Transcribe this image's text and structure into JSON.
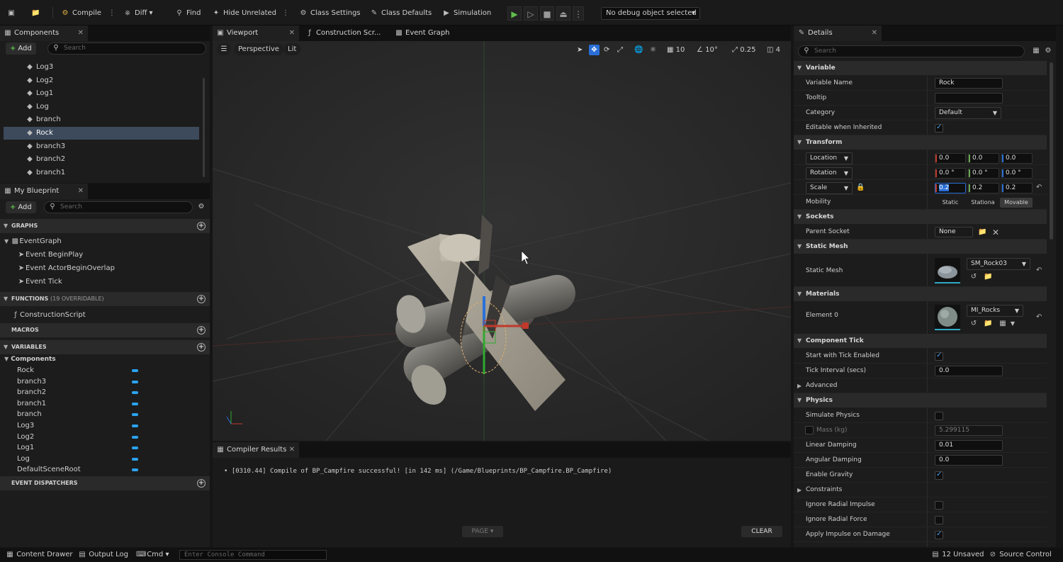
{
  "toolbar": {
    "compile": "Compile",
    "diff": "Diff",
    "find": "Find",
    "hide_unrelated": "Hide Unrelated",
    "class_settings": "Class Settings",
    "class_defaults": "Class Defaults",
    "simulation": "Simulation",
    "debug_object": "No debug object selected"
  },
  "components_panel": {
    "tab": "Components",
    "add": "Add",
    "search_placeholder": "Search",
    "items": [
      "Log3",
      "Log2",
      "Log1",
      "Log",
      "branch",
      "Rock",
      "branch3",
      "branch2",
      "branch1"
    ],
    "selected": "Rock"
  },
  "blueprint_panel": {
    "tab": "My Blueprint",
    "add": "Add",
    "search_placeholder": "Search",
    "graphs_header": "GRAPHS",
    "event_graph": "EventGraph",
    "events": [
      "Event BeginPlay",
      "Event ActorBeginOverlap",
      "Event Tick"
    ],
    "functions_header": "FUNCTIONS",
    "functions_count": "(19 OVERRIDABLE)",
    "construction_script": "ConstructionScript",
    "macros_header": "MACROS",
    "variables_header": "VARIABLES",
    "components_group": "Components",
    "variables": [
      "Rock",
      "branch3",
      "branch2",
      "branch1",
      "branch",
      "Log3",
      "Log2",
      "Log1",
      "Log",
      "DefaultSceneRoot"
    ],
    "dispatchers_header": "EVENT DISPATCHERS"
  },
  "editor_tabs": [
    "Viewport",
    "Construction Scr...",
    "Event Graph"
  ],
  "viewport": {
    "perspective": "Perspective",
    "lit": "Lit",
    "grid_snap": "10",
    "rot_snap": "10°",
    "scale_snap": "0.25",
    "camera_speed": "4"
  },
  "compiler": {
    "tab": "Compiler Results",
    "message": "• [0310.44] Compile of BP_Campfire successful! [in 142 ms] (/Game/Blueprints/BP_Campfire.BP_Campfire)",
    "page": "PAGE",
    "clear": "CLEAR"
  },
  "details": {
    "tab": "Details",
    "search_placeholder": "Search",
    "variable_header": "Variable",
    "variable_name_label": "Variable Name",
    "variable_name": "Rock",
    "tooltip_label": "Tooltip",
    "category_label": "Category",
    "category": "Default",
    "editable_label": "Editable when Inherited",
    "transform_header": "Transform",
    "location_label": "Location",
    "location": [
      "0.0",
      "0.0",
      "0.0"
    ],
    "rotation_label": "Rotation",
    "rotation": [
      "0.0 °",
      "0.0 °",
      "0.0 °"
    ],
    "scale_label": "Scale",
    "scale": [
      "0.2",
      "0.2",
      "0.2"
    ],
    "mobility_label": "Mobility",
    "mobility_options": [
      "Static",
      "Stationa",
      "Movable"
    ],
    "sockets_header": "Sockets",
    "parent_socket_label": "Parent Socket",
    "parent_socket": "None",
    "static_mesh_header": "Static Mesh",
    "static_mesh_label": "Static Mesh",
    "static_mesh": "SM_Rock03",
    "materials_header": "Materials",
    "element0_label": "Element 0",
    "element0": "MI_Rocks",
    "tick_header": "Component Tick",
    "start_tick_label": "Start with Tick Enabled",
    "tick_interval_label": "Tick Interval (secs)",
    "tick_interval": "0.0",
    "advanced_label": "Advanced",
    "physics_header": "Physics",
    "simulate_label": "Simulate Physics",
    "mass_label": "Mass (kg)",
    "mass": "5.299115",
    "linear_damping_label": "Linear Damping",
    "linear_damping": "0.01",
    "angular_damping_label": "Angular Damping",
    "angular_damping": "0.0",
    "gravity_label": "Enable Gravity",
    "constraints_label": "Constraints",
    "ignore_radial_impulse_label": "Ignore Radial Impulse",
    "ignore_radial_force_label": "Ignore Radial Force",
    "apply_impulse_label": "Apply Impulse on Damage"
  },
  "statusbar": {
    "content_drawer": "Content Drawer",
    "output_log": "Output Log",
    "cmd": "Cmd",
    "console_placeholder": "Enter Console Command",
    "unsaved": "12 Unsaved",
    "source_control": "Source Control"
  },
  "colors": {
    "selection": "#3c4a5c",
    "accent_blue": "#2a6fd8",
    "variable_pill": "#2aa4f4",
    "play_green": "#5fbf4c"
  }
}
